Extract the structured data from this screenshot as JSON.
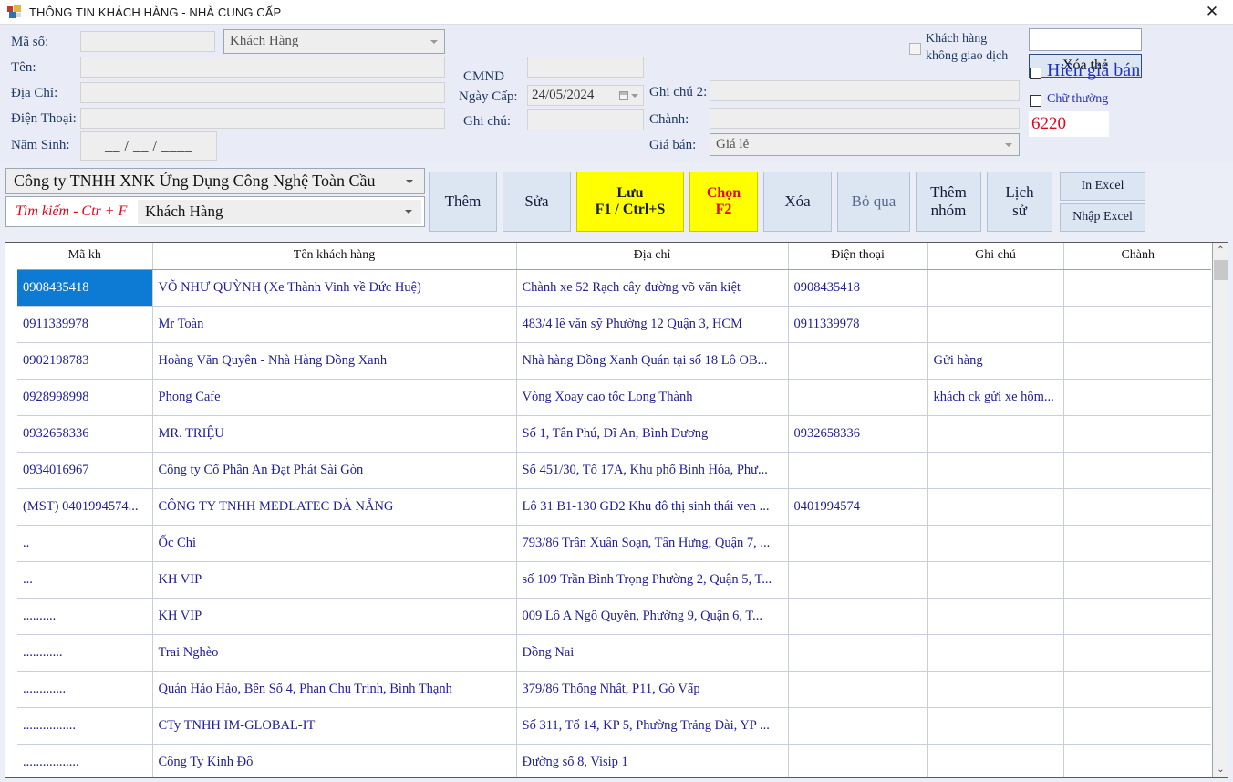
{
  "window": {
    "title": "THÔNG TIN KHÁCH HÀNG - NHÀ CUNG CẤP",
    "close_label": "✕",
    "icon": "windows-form-icon"
  },
  "form": {
    "labels": {
      "ma_so": "Mã số:",
      "ten": "Tên:",
      "dia_chi": "Địa Chỉ:",
      "dien_thoai": "Điện Thoại:",
      "nam_sinh": "Năm Sinh:",
      "cmnd": "CMND",
      "ngay_cap": "Ngày Cấp:",
      "ghi_chu": "Ghi chú:",
      "ghi_chu_2": "Ghi chú 2:",
      "chanh": "Chành:",
      "gia_ban": "Giá bán:"
    },
    "values": {
      "ma_so": "",
      "ten": "",
      "dia_chi": "",
      "dien_thoai": "",
      "nam_sinh": "__ / __ / ____",
      "cmnd": "",
      "ngay_cap": "24/05/2024",
      "ghi_chu": "",
      "ghi_chu_2": "",
      "chanh": "",
      "gia_ban": "Giá lẻ",
      "loai": "Khách Hàng",
      "card_code": ""
    },
    "checkbox_khach_hang_khong_giao_dich": {
      "line1": "Khách hàng",
      "line2": "không giao dịch",
      "checked": false
    },
    "xoa_the_button": "Xóa thẻ",
    "hien_gia_ban": {
      "label": "Hiện giá bán",
      "checked": false
    },
    "chu_thuong": {
      "label": "Chữ thường",
      "checked": false
    },
    "counter_value": "6220"
  },
  "toolbar": {
    "company": "Công ty TNHH XNK Ứng Dụng Công Nghệ Toàn Cầu",
    "search_hint": "Tìm kiếm - Ctr + F",
    "search_category": "Khách Hàng",
    "buttons": [
      {
        "name": "them",
        "line1": "Thêm",
        "line2": ""
      },
      {
        "name": "sua",
        "line1": "Sửa",
        "line2": ""
      },
      {
        "name": "luu",
        "line1": "Lưu",
        "line2": "F1 / Ctrl+S"
      },
      {
        "name": "chon",
        "line1": "Chọn",
        "line2": "F2"
      },
      {
        "name": "xoa",
        "line1": "Xóa",
        "line2": ""
      },
      {
        "name": "bo-qua",
        "line1": "Bỏ qua",
        "line2": ""
      },
      {
        "name": "them-nhom",
        "line1": "Thêm",
        "line2": "nhóm"
      },
      {
        "name": "lich-su",
        "line1": "Lịch",
        "line2": "sử"
      }
    ],
    "in_excel": "In Excel",
    "nhap_excel": "Nhập Excel"
  },
  "grid": {
    "columns": [
      "Mã kh",
      "Tên khách hàng",
      "Địa chỉ",
      "Điện thoại",
      "Ghi chú",
      "Chành"
    ],
    "selected_row_index": 0,
    "rows": [
      {
        "ma_kh": "0908435418",
        "ten": "VÕ NHƯ QUỲNH (Xe Thành Vinh về Đức Huệ)",
        "dia_chi": "Chành xe 52 Rạch cây đường võ văn kiệt",
        "dien_thoai": "0908435418",
        "ghi_chu": "",
        "chanh": ""
      },
      {
        "ma_kh": "0911339978",
        "ten": "Mr Toàn",
        "dia_chi": "483/4 lê văn sỹ Phường 12 Quận 3, HCM",
        "dien_thoai": "0911339978",
        "ghi_chu": "",
        "chanh": ""
      },
      {
        "ma_kh": "0902198783",
        "ten": "Hoàng Văn Quyên - Nhà Hàng Đồng Xanh",
        "dia_chi": "Nhà hàng Đồng Xanh Quán tại số 18 Lô OB...",
        "dien_thoai": "",
        "ghi_chu": "Gửi hàng",
        "chanh": ""
      },
      {
        "ma_kh": "0928998998",
        "ten": "Phong Cafe",
        "dia_chi": "Vòng Xoay cao tốc Long Thành",
        "dien_thoai": "",
        "ghi_chu": "khách ck gửi xe hôm...",
        "chanh": ""
      },
      {
        "ma_kh": "0932658336",
        "ten": "MR. TRIỆU",
        "dia_chi": "Số 1, Tân Phú, Dĩ An, Bình Dương",
        "dien_thoai": "0932658336",
        "ghi_chu": "",
        "chanh": ""
      },
      {
        "ma_kh": "0934016967",
        "ten": "Công ty Cổ Phần An Đạt Phát Sài Gòn",
        "dia_chi": "Số 451/30, Tổ 17A, Khu phố Bình Hóa, Phư...",
        "dien_thoai": "",
        "ghi_chu": "",
        "chanh": ""
      },
      {
        "ma_kh": "(MST) 0401994574...",
        "ten": "CÔNG TY TNHH MEDLATEC ĐÀ NẴNG",
        "dia_chi": "Lô 31 B1-130 GĐ2 Khu đô thị sinh thái ven ...",
        "dien_thoai": "0401994574",
        "ghi_chu": "",
        "chanh": ""
      },
      {
        "ma_kh": "..",
        "ten": "Ốc Chi",
        "dia_chi": "793/86 Trần Xuân Soạn, Tân Hưng, Quận 7, ...",
        "dien_thoai": "",
        "ghi_chu": "",
        "chanh": ""
      },
      {
        "ma_kh": "...",
        "ten": "KH VIP",
        "dia_chi": "số 109 Trần Bình Trọng Phường 2, Quận 5, T...",
        "dien_thoai": "",
        "ghi_chu": "",
        "chanh": ""
      },
      {
        "ma_kh": "..........",
        "ten": "KH VIP",
        "dia_chi": "009  Lô  A Ngô Quyền, Phường 9, Quận 6, T...",
        "dien_thoai": "",
        "ghi_chu": "",
        "chanh": ""
      },
      {
        "ma_kh": "............",
        "ten": "Trai Nghèo",
        "dia_chi": "Đồng Nai",
        "dien_thoai": "",
        "ghi_chu": "",
        "chanh": ""
      },
      {
        "ma_kh": ".............",
        "ten": "Quán Hảo Hảo, Bến Số 4, Phan Chu Trinh, Bình Thạnh",
        "dia_chi": "379/86 Thống Nhất, P11, Gò Vấp",
        "dien_thoai": "",
        "ghi_chu": "",
        "chanh": ""
      },
      {
        "ma_kh": "................",
        "ten": "CTy TNHH IM-GLOBAL-IT",
        "dia_chi": "Số 311, Tổ 14, KP 5, Phường Trảng Dài, YP ...",
        "dien_thoai": "",
        "ghi_chu": "",
        "chanh": ""
      },
      {
        "ma_kh": ".................",
        "ten": "Công Ty Kinh Đô",
        "dia_chi": "Đường số 8, Visip 1",
        "dien_thoai": "",
        "ghi_chu": "",
        "chanh": ""
      }
    ],
    "scroll_up_icon": "⌃",
    "scroll_down_icon": "⌄"
  },
  "colors": {
    "accent_yellow": "#ffff00",
    "selection_blue": "#0d7ad4",
    "text_blue": "#20209c",
    "label_blue": "#1f3864",
    "alert_red": "#e2061a",
    "panel": "#e9ecf7"
  }
}
